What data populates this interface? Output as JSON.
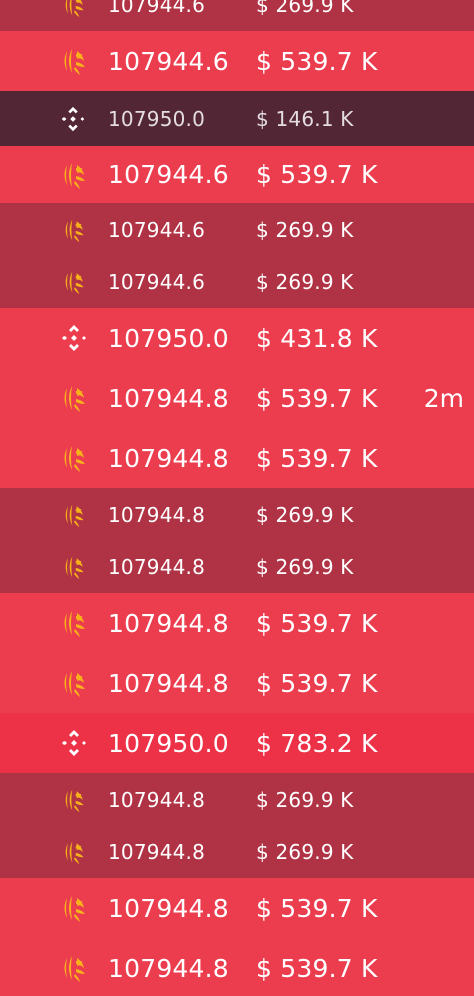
{
  "feed": {
    "rows": [
      {
        "exchange": "binance",
        "icon": "burst-exchange-icon",
        "price": "107944.6",
        "amount": "$ 269.9 K",
        "age": "",
        "size": "small"
      },
      {
        "exchange": "binance",
        "icon": "burst-exchange-icon",
        "price": "107944.6",
        "amount": "$ 539.7 K",
        "age": "",
        "size": "big"
      },
      {
        "exchange": "binance",
        "icon": "diamond-exchange-icon",
        "price": "107950.0",
        "amount": "$ 146.1 K",
        "age": "",
        "size": "dark"
      },
      {
        "exchange": "binance",
        "icon": "burst-exchange-icon",
        "price": "107944.6",
        "amount": "$ 539.7 K",
        "age": "",
        "size": "big"
      },
      {
        "exchange": "binance",
        "icon": "burst-exchange-icon",
        "price": "107944.6",
        "amount": "$ 269.9 K",
        "age": "",
        "size": "small"
      },
      {
        "exchange": "binance",
        "icon": "burst-exchange-icon",
        "price": "107944.6",
        "amount": "$ 269.9 K",
        "age": "",
        "size": "small"
      },
      {
        "exchange": "binance",
        "icon": "diamond-exchange-icon",
        "price": "107950.0",
        "amount": "$ 431.8 K",
        "age": "",
        "size": "big"
      },
      {
        "exchange": "binance",
        "icon": "burst-exchange-icon",
        "price": "107944.8",
        "amount": "$ 539.7 K",
        "age": "2m",
        "size": "big"
      },
      {
        "exchange": "binance",
        "icon": "burst-exchange-icon",
        "price": "107944.8",
        "amount": "$ 539.7 K",
        "age": "",
        "size": "big"
      },
      {
        "exchange": "binance",
        "icon": "burst-exchange-icon",
        "price": "107944.8",
        "amount": "$ 269.9 K",
        "age": "",
        "size": "small"
      },
      {
        "exchange": "binance",
        "icon": "burst-exchange-icon",
        "price": "107944.8",
        "amount": "$ 269.9 K",
        "age": "",
        "size": "small"
      },
      {
        "exchange": "binance",
        "icon": "burst-exchange-icon",
        "price": "107944.8",
        "amount": "$ 539.7 K",
        "age": "",
        "size": "big"
      },
      {
        "exchange": "binance",
        "icon": "burst-exchange-icon",
        "price": "107944.8",
        "amount": "$ 539.7 K",
        "age": "",
        "size": "big"
      },
      {
        "exchange": "binance",
        "icon": "diamond-exchange-icon",
        "price": "107950.0",
        "amount": "$ 783.2 K",
        "age": "",
        "size": "strong"
      },
      {
        "exchange": "binance",
        "icon": "burst-exchange-icon",
        "price": "107944.8",
        "amount": "$ 269.9 K",
        "age": "",
        "size": "small"
      },
      {
        "exchange": "binance",
        "icon": "burst-exchange-icon",
        "price": "107944.8",
        "amount": "$ 269.9 K",
        "age": "",
        "size": "small"
      },
      {
        "exchange": "binance",
        "icon": "burst-exchange-icon",
        "price": "107944.8",
        "amount": "$ 539.7 K",
        "age": "",
        "size": "big"
      },
      {
        "exchange": "binance",
        "icon": "burst-exchange-icon",
        "price": "107944.8",
        "amount": "$ 539.7 K",
        "age": "",
        "size": "big"
      }
    ]
  },
  "colors": {
    "big_row": "#ec3d4f",
    "small_row": "#b03345",
    "dark_row": "#532636",
    "strong_row": "#ed3146",
    "burst_icon": "#f7b21a",
    "diamond_icon": "#ffffff"
  }
}
